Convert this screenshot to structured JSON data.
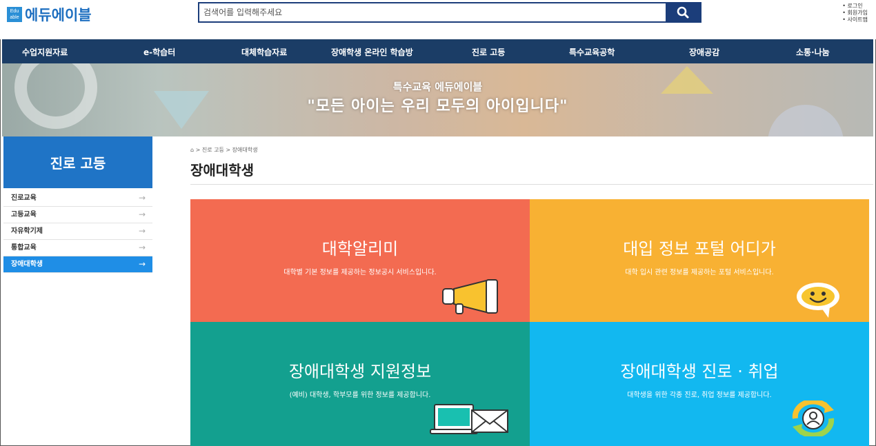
{
  "header": {
    "logo_badge_line1": "Edu",
    "logo_badge_line2": "able",
    "logo_text": "에듀에이블",
    "search_placeholder": "검색어를 입력해주세요",
    "search_icon": "search-icon",
    "util_links": [
      "로그인",
      "회원가입",
      "사이트맵"
    ]
  },
  "nav": {
    "items": [
      "수업지원자료",
      "e-학습터",
      "대체학습자료",
      "장애학생 온라인 학습방",
      "진로 고등",
      "특수교육공학",
      "장애공감",
      "소통·나눔"
    ]
  },
  "banner": {
    "subtitle": "특수교육 에듀에이블",
    "title": "\"모든 아이는 우리 모두의 아이입니다\""
  },
  "sidebar": {
    "heading": "진로 고등",
    "items": [
      {
        "label": "진로교육",
        "active": false
      },
      {
        "label": "고등교육",
        "active": false
      },
      {
        "label": "자유학기제",
        "active": false
      },
      {
        "label": "통합교육",
        "active": false
      },
      {
        "label": "장애대학생",
        "active": true
      }
    ],
    "arrow": "→"
  },
  "content": {
    "breadcrumb": "⌂ > 진로 고등 > 장애대학생",
    "page_title": "장애대학생",
    "tiles": [
      {
        "title": "대학알리미",
        "desc": "대학별 기본 정보를 제공하는 정보공시 서비스입니다.",
        "icon": "megaphone-icon",
        "color": "#f36b51"
      },
      {
        "title": "대입 정보 포털 어디가",
        "desc": "대학 입시 관련 정보를 제공하는 포털 서비스입니다.",
        "icon": "smiley-speech-bubble-icon",
        "color": "#f8b133"
      },
      {
        "title": "장애대학생 지원정보",
        "desc": "(예비) 대학생, 학부모를 위한 정보를 제공합니다.",
        "icon": "laptop-mail-icon",
        "color": "#13a08f"
      },
      {
        "title": "장애대학생 진로 · 취업",
        "desc": "대학생을 위한 각종 진로, 취업 정보를 제공합니다.",
        "icon": "person-refresh-icon",
        "color": "#12b8f0"
      }
    ]
  }
}
